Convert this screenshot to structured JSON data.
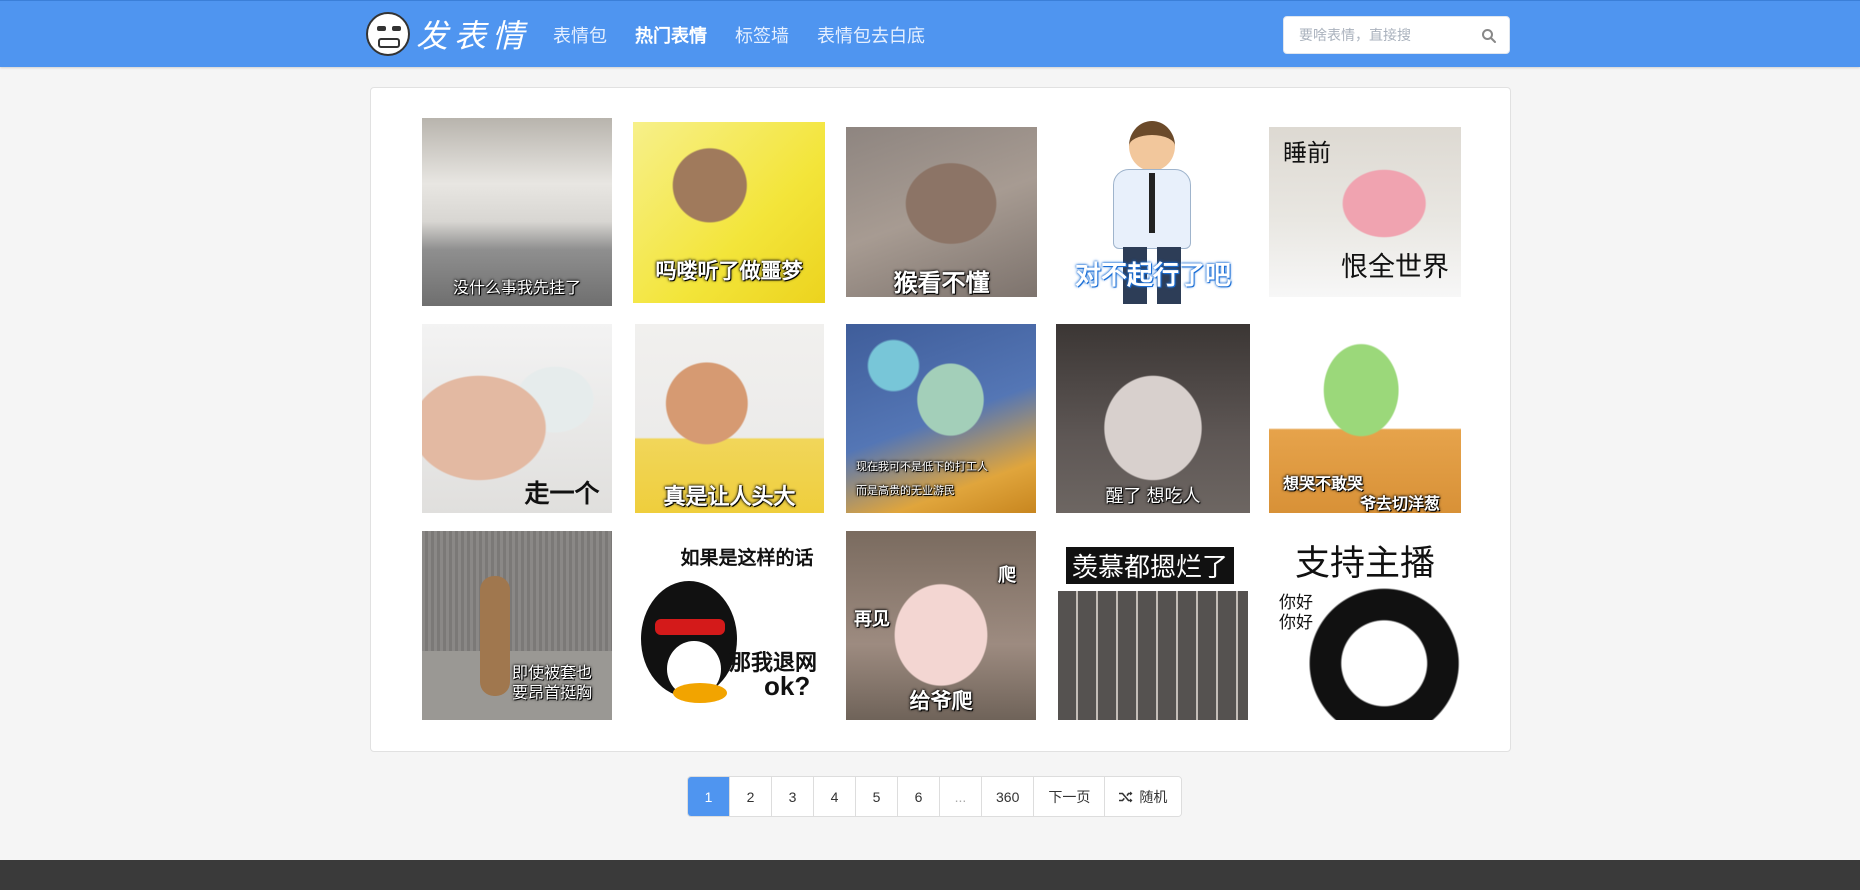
{
  "header": {
    "brand": "发表情",
    "nav": [
      {
        "label": "表情包",
        "active": false
      },
      {
        "label": "热门表情",
        "active": true
      },
      {
        "label": "标签墙",
        "active": false
      },
      {
        "label": "表情包去白底",
        "active": false
      }
    ],
    "search_placeholder": "要啥表情，直接搜"
  },
  "grid": [
    {
      "caption": "没什么事我先挂了"
    },
    {
      "caption": "吗喽听了做噩梦"
    },
    {
      "caption": "猴看不懂"
    },
    {
      "caption": "对不起行了吧"
    },
    {
      "caption_top": "睡前",
      "caption": "恨全世界"
    },
    {
      "caption": "走一个"
    },
    {
      "caption": "真是让人头大"
    },
    {
      "caption_top": "现在我可不是低下的打工人",
      "caption": "而是高贵的无业游民"
    },
    {
      "caption": "醒了 想吃人"
    },
    {
      "caption_top": "想哭不敢哭",
      "caption": "爷去切洋葱"
    },
    {
      "caption_top": "即使被套也",
      "caption": "要昂首挺胸"
    },
    {
      "caption_top": "如果是这样的话",
      "caption_mid": "那我退网",
      "caption": "ok?"
    },
    {
      "caption_top": "爬",
      "caption_mid": "再见",
      "caption": "给爷爬"
    },
    {
      "caption": "羡慕都摁烂了"
    },
    {
      "caption_top": "支持主播",
      "caption_mid": "你好\n你好"
    }
  ],
  "pagination": {
    "pages": [
      "1",
      "2",
      "3",
      "4",
      "5",
      "6",
      "...",
      "360"
    ],
    "current": "1",
    "next": "下一页",
    "random": "随机"
  },
  "colors": {
    "accent": "#4f95f0",
    "footer": "#3a3a3a"
  }
}
